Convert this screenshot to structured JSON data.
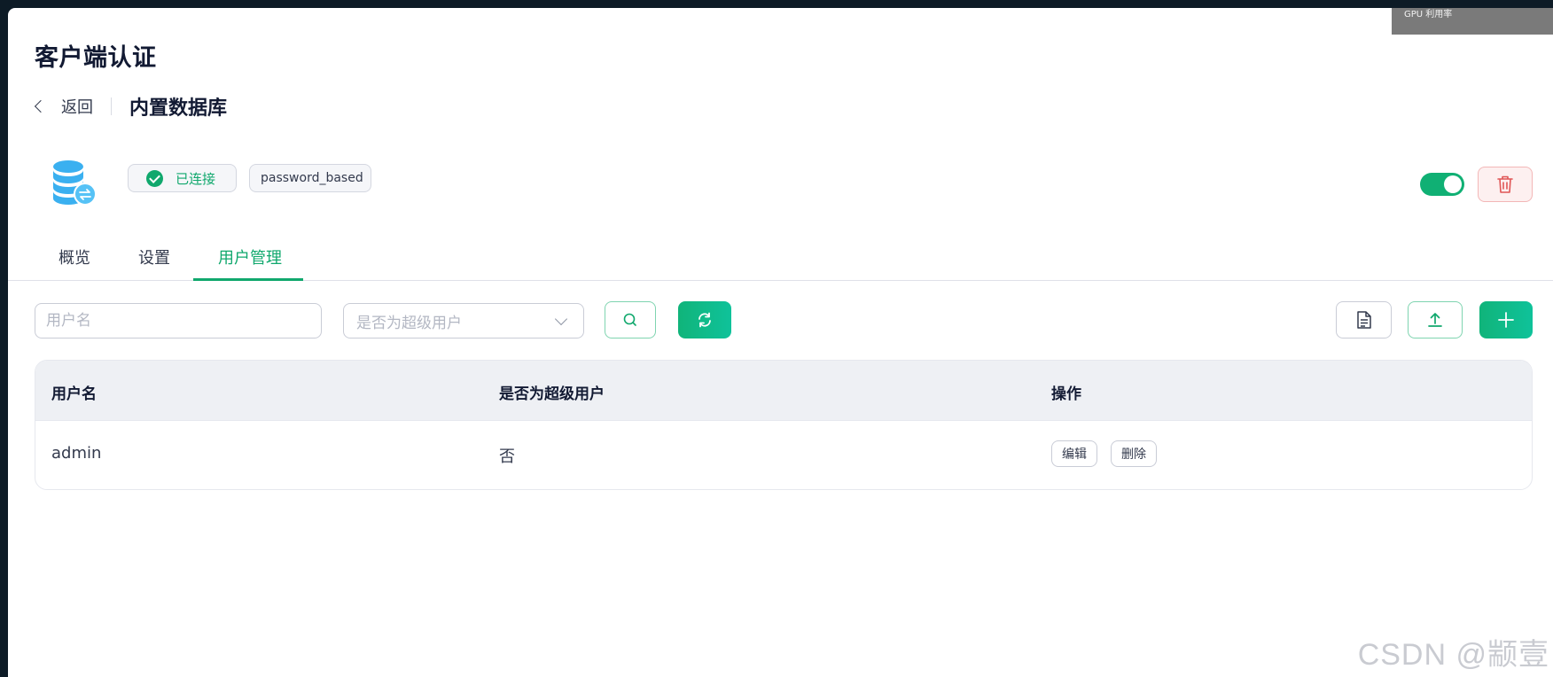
{
  "overlay": {
    "gpu_label": "GPU 利用率"
  },
  "header": {
    "title": "客户端认证",
    "back_label": "返回",
    "subtitle": "内置数据库"
  },
  "resource": {
    "icon": "database-icon",
    "status_tag": "已连接",
    "auth_tag": "password_based",
    "enabled": true
  },
  "tabs": [
    {
      "label": "概览",
      "active": false
    },
    {
      "label": "设置",
      "active": false
    },
    {
      "label": "用户管理",
      "active": true
    }
  ],
  "toolbar": {
    "username_placeholder": "用户名",
    "superuser_placeholder": "是否为超级用户"
  },
  "table": {
    "columns": [
      "用户名",
      "是否为超级用户",
      "操作"
    ],
    "rows": [
      {
        "username": "admin",
        "is_superuser": "否",
        "edit_label": "编辑",
        "delete_label": "删除"
      }
    ]
  },
  "watermark": "CSDN @颛壹",
  "colors": {
    "accent": "#10a86d",
    "danger": "#e05656",
    "title": "#121a33"
  }
}
